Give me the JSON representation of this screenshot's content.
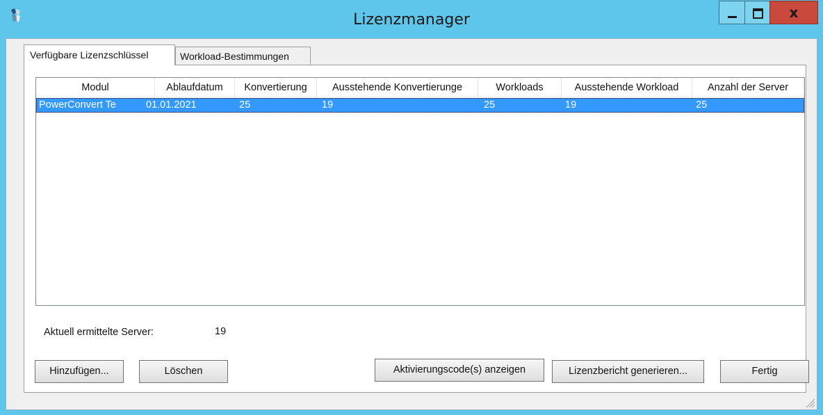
{
  "window": {
    "title": "Lizenzmanager",
    "close_label": "x"
  },
  "tabs": [
    {
      "label": "Verfügbare Lizenzschlüssel",
      "active": true
    },
    {
      "label": "Workload-Bestimmungen",
      "active": false
    }
  ],
  "list": {
    "columns": [
      "Modul",
      "Ablaufdatum",
      "Konvertierung",
      "Ausstehende Konvertierunge",
      "Workloads",
      "Ausstehende Workload",
      "Anzahl der Server"
    ],
    "rows": [
      [
        "PowerConvert Te",
        "01.01.2021",
        "25",
        "19",
        "25",
        "19",
        "25"
      ]
    ],
    "selected_row": 0
  },
  "server_count": {
    "label": "Aktuell ermittelte Server:",
    "value": "19"
  },
  "buttons": {
    "add": "Hinzufügen...",
    "delete": "Löschen",
    "show_codes": "Aktivierungscode(s) anzeigen",
    "report": "Lizenzbericht generieren...",
    "done": "Fertig"
  },
  "colors": {
    "titlebar": "#5ec6ea",
    "selection": "#3399ff",
    "close_button": "#c94a3d"
  }
}
